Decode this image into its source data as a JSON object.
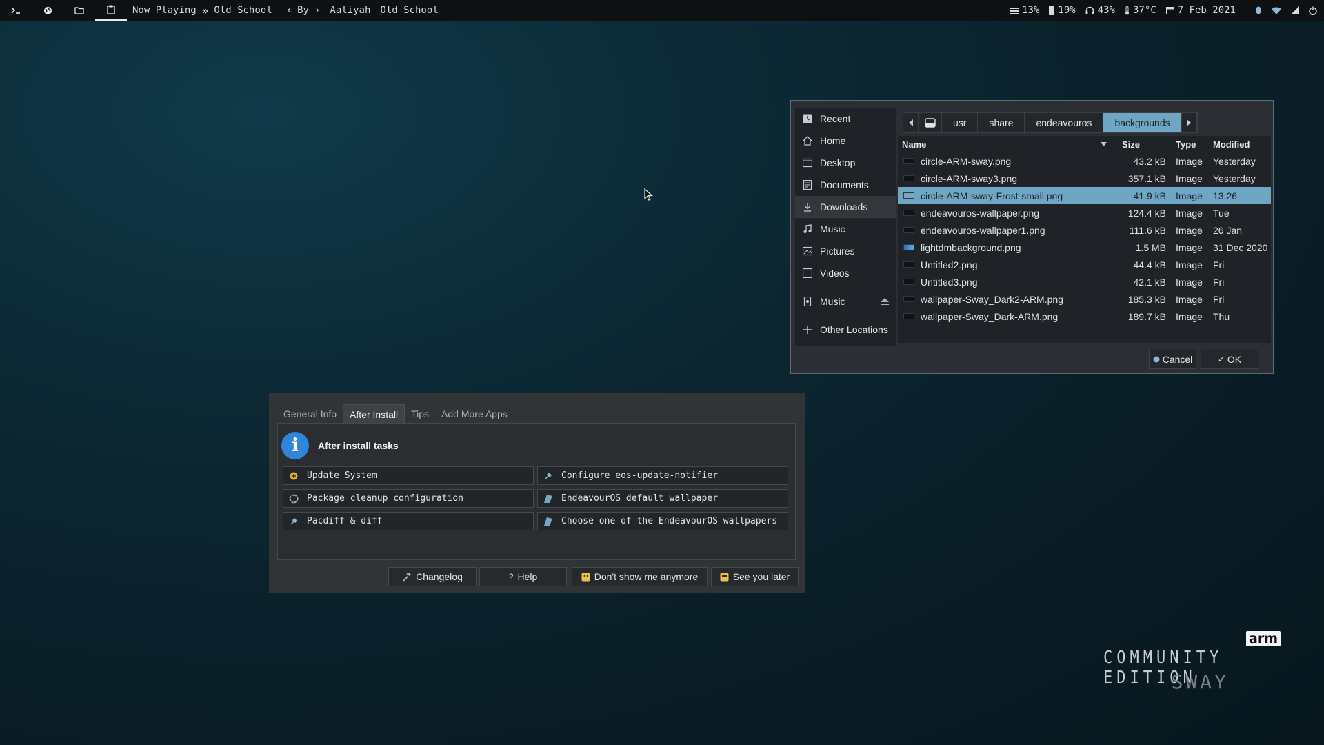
{
  "topbar": {
    "workspaces": [
      {
        "icon": "terminal-icon"
      },
      {
        "icon": "globe-icon"
      },
      {
        "icon": "folder-icon"
      },
      {
        "icon": "clipboard-icon",
        "active": true
      }
    ],
    "now_playing": "Now Playing",
    "track_title": "Old School",
    "by_label": "By",
    "artist": "Aaliyah",
    "album": "Old School",
    "cpu": "13%",
    "memory": "19%",
    "volume": "43%",
    "temperature": "37°C",
    "date": "7 Feb 2021"
  },
  "file_chooser": {
    "places": [
      {
        "label": "Recent",
        "icon": "recent-icon"
      },
      {
        "label": "Home",
        "icon": "home-icon"
      },
      {
        "label": "Desktop",
        "icon": "desktop-icon"
      },
      {
        "label": "Documents",
        "icon": "documents-icon"
      },
      {
        "label": "Downloads",
        "icon": "downloads-icon",
        "selected": true
      },
      {
        "label": "Music",
        "icon": "music-icon"
      },
      {
        "label": "Pictures",
        "icon": "pictures-icon"
      },
      {
        "label": "Videos",
        "icon": "videos-icon"
      }
    ],
    "device": {
      "label": "Music",
      "icon": "drive-icon"
    },
    "other_locations": "Other Locations",
    "path": [
      "usr",
      "share",
      "endeavouros",
      "backgrounds"
    ],
    "columns": {
      "name": "Name",
      "size": "Size",
      "type": "Type",
      "modified": "Modified"
    },
    "files": [
      {
        "name": "circle-ARM-sway.png",
        "size": "43.2 kB",
        "type": "Image",
        "modified": "Yesterday",
        "thumb": "dark"
      },
      {
        "name": "circle-ARM-sway3.png",
        "size": "357.1 kB",
        "type": "Image",
        "modified": "Yesterday",
        "thumb": "dark"
      },
      {
        "name": "circle-ARM-sway-Frost-small.png",
        "size": "41.9 kB",
        "type": "Image",
        "modified": "13:26",
        "thumb": "light",
        "selected": true
      },
      {
        "name": "endeavouros-wallpaper.png",
        "size": "124.4 kB",
        "type": "Image",
        "modified": "Tue",
        "thumb": "dark"
      },
      {
        "name": "endeavouros-wallpaper1.png",
        "size": "111.6 kB",
        "type": "Image",
        "modified": "26 Jan",
        "thumb": "dark"
      },
      {
        "name": "lightdmbackground.png",
        "size": "1.5 MB",
        "type": "Image",
        "modified": "31 Dec 2020",
        "thumb": "blue"
      },
      {
        "name": "Untitled2.png",
        "size": "44.4 kB",
        "type": "Image",
        "modified": "Fri",
        "thumb": "dark"
      },
      {
        "name": "Untitled3.png",
        "size": "42.1 kB",
        "type": "Image",
        "modified": "Fri",
        "thumb": "dark"
      },
      {
        "name": "wallpaper-Sway_Dark2-ARM.png",
        "size": "185.3 kB",
        "type": "Image",
        "modified": "Fri",
        "thumb": "dark"
      },
      {
        "name": "wallpaper-Sway_Dark-ARM.png",
        "size": "189.7 kB",
        "type": "Image",
        "modified": "Thu",
        "thumb": "dark"
      }
    ],
    "cancel_label": "Cancel",
    "ok_label": "OK"
  },
  "welcome": {
    "tabs": [
      {
        "label": "General Info"
      },
      {
        "label": "After Install",
        "active": true
      },
      {
        "label": "Tips"
      },
      {
        "label": "Add More Apps"
      }
    ],
    "heading": "After install tasks",
    "tasks": [
      {
        "label": "Update System",
        "icon": "update-icon"
      },
      {
        "label": "Configure eos-update-notifier",
        "icon": "configure-icon"
      },
      {
        "label": "Package cleanup configuration",
        "icon": "cleanup-icon"
      },
      {
        "label": "EndeavourOS default wallpaper",
        "icon": "wallpaper-icon"
      },
      {
        "label": "Pacdiff & diff",
        "icon": "diff-icon"
      },
      {
        "label": "Choose one of the EndeavourOS wallpapers",
        "icon": "wallpaper-icon"
      }
    ],
    "buttons": {
      "changelog": "Changelog",
      "help": "Help",
      "dont_show": "Don't show me anymore",
      "see_later": "See you later"
    }
  },
  "branding": {
    "arm": "arm",
    "edition": "COMMUNITY EDITION",
    "wm": "SWAY"
  },
  "colors": {
    "accent": "#6fa6c4",
    "info_icon": "#2f85d8",
    "topbar_bg": "#0e1114"
  }
}
